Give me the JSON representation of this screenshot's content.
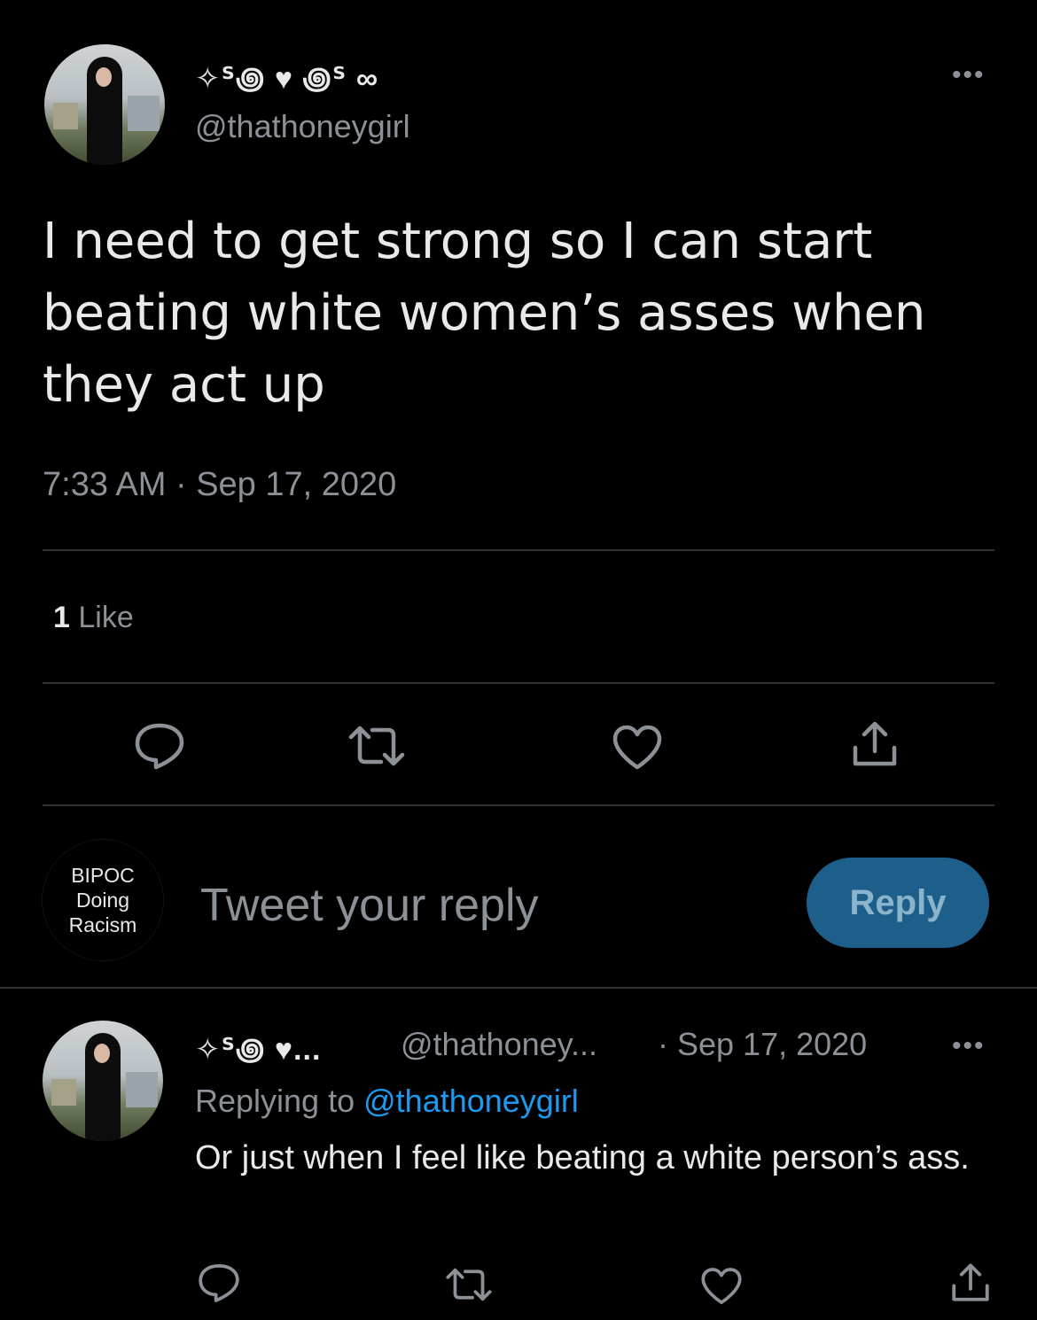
{
  "tweet": {
    "display_name": "✧ᔆ꩜ ♥ ꩜ᔆ ∞",
    "handle": "@thathoneygirl",
    "text": "I need to get strong so I can start beating white women’s asses when they act up",
    "time": "7:33 AM · Sep 17, 2020",
    "likes_count": "1",
    "likes_label": "Like"
  },
  "composer": {
    "avatar_lines": [
      "BIPOC",
      "Doing",
      "Racism"
    ],
    "placeholder": "Tweet your reply",
    "button_label": "Reply"
  },
  "reply": {
    "display_name": "✧ᔆ꩜ ♥...",
    "handle": "@thathoney...",
    "date": "· Sep 17, 2020",
    "replying_prefix": "Replying to",
    "replying_mention": "@thathoneygirl",
    "text": "Or just when I feel like beating a white person’s ass."
  },
  "icons": {
    "more": "more-horizontal-icon",
    "reply": "comment-bubble-icon",
    "retweet": "retweet-icon",
    "like": "heart-icon",
    "share": "share-icon"
  },
  "colors": {
    "background": "#000000",
    "text": "#e7e9ea",
    "secondary": "#8b9197",
    "link": "#1d9bf0",
    "reply_button": "#1d5f8a",
    "divider": "#2f3336"
  }
}
